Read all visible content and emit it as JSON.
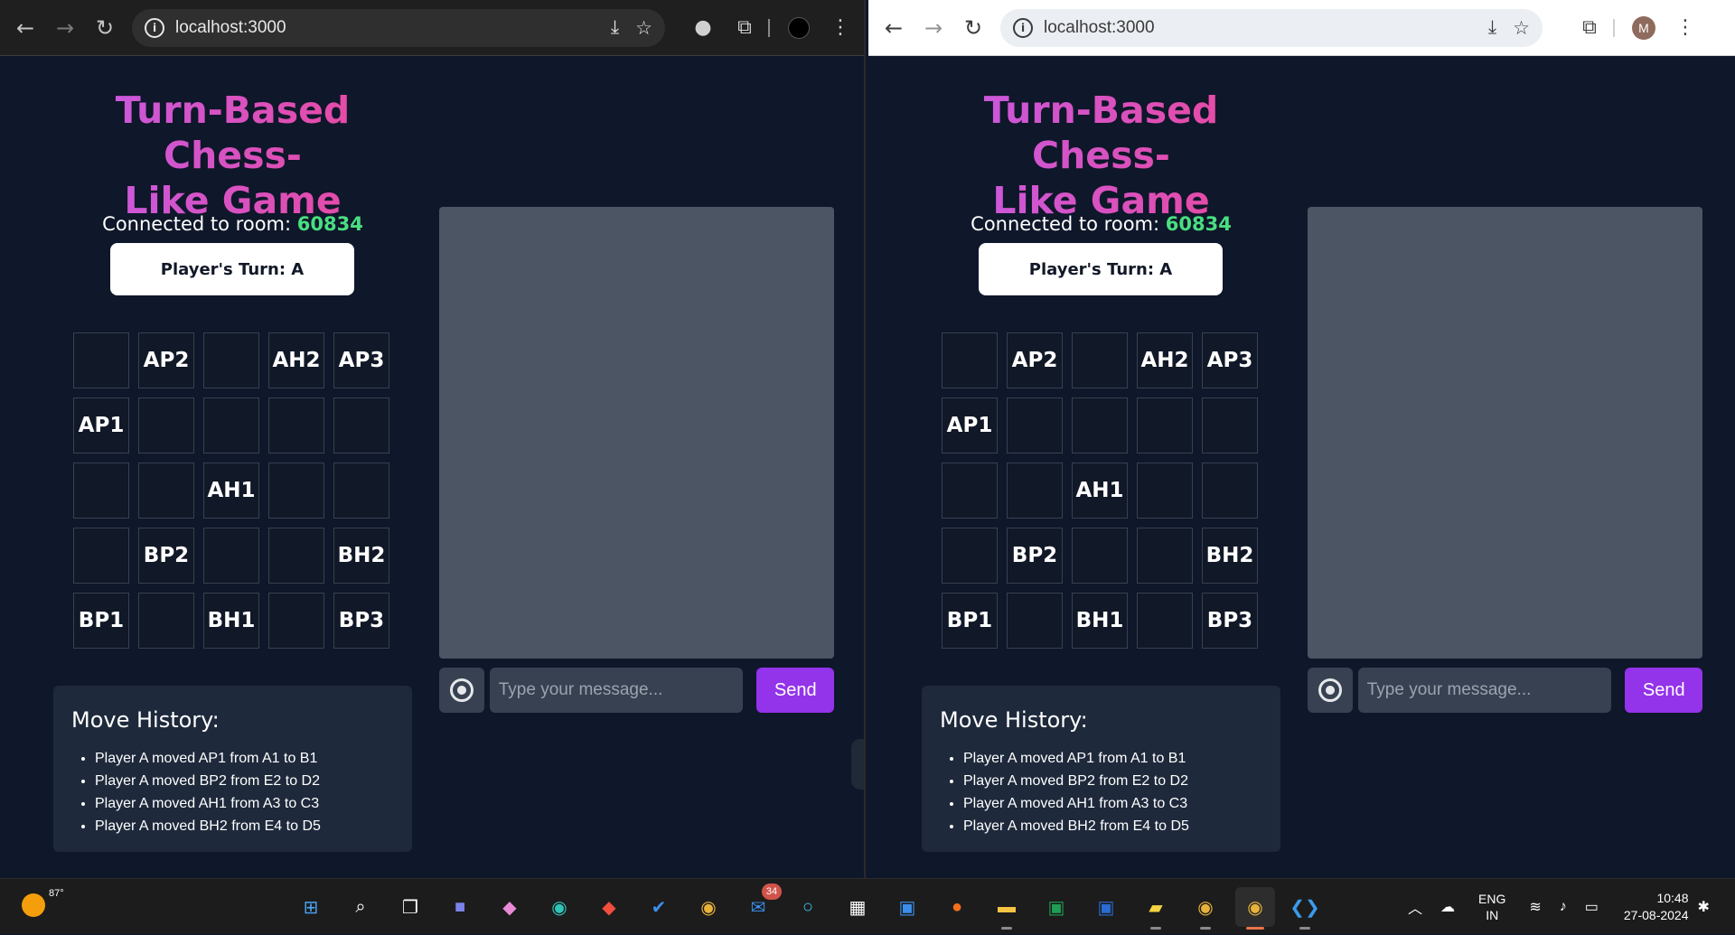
{
  "browser": {
    "url": "localhost:3000"
  },
  "game": {
    "title_line1": "Turn-Based Chess-",
    "title_line2": "Like Game",
    "room_label": "Connected to room: ",
    "room_code": "60834",
    "turn_text": "Player's Turn: A",
    "board": [
      [
        "",
        "AP2",
        "",
        "AH2",
        "AP3"
      ],
      [
        "AP1",
        "",
        "",
        "",
        ""
      ],
      [
        "",
        "",
        "AH1",
        "",
        ""
      ],
      [
        "",
        "BP2",
        "",
        "",
        "BH2"
      ],
      [
        "BP1",
        "",
        "BH1",
        "",
        "BP3"
      ]
    ],
    "history_title": "Move History:",
    "history": [
      "Player A moved AP1 from A1 to B1",
      "Player A moved BP2 from E2 to D2",
      "Player A moved AH1 from A3 to C3",
      "Player A moved BH2 from E4 to D5"
    ],
    "chat_placeholder": "Type your message...",
    "send_label": "Send"
  },
  "colors": {
    "background": "#0f172a",
    "accent_pink": "#ec4899",
    "room_code": "#4ade80",
    "send_button": "#9333ea",
    "chat_panel": "#4b5563"
  },
  "taskbar": {
    "temperature": "87°",
    "mail_badge": "34",
    "lang_line1": "ENG",
    "lang_line2": "IN",
    "time": "10:48",
    "date": "27-08-2024",
    "apps": [
      "start-icon",
      "search-icon",
      "task-view-icon",
      "video-call-icon",
      "copilot-icon",
      "edge-icon",
      "git-icon",
      "todo-icon",
      "chrome-icon",
      "mail-icon",
      "cortana-icon",
      "store-icon",
      "vscode-alt-icon",
      "firefox-icon",
      "file-explorer-icon",
      "excel-icon",
      "word-icon",
      "sticky-notes-icon",
      "chrome-profile-icon",
      "chrome-active-icon",
      "vscode-icon"
    ]
  }
}
